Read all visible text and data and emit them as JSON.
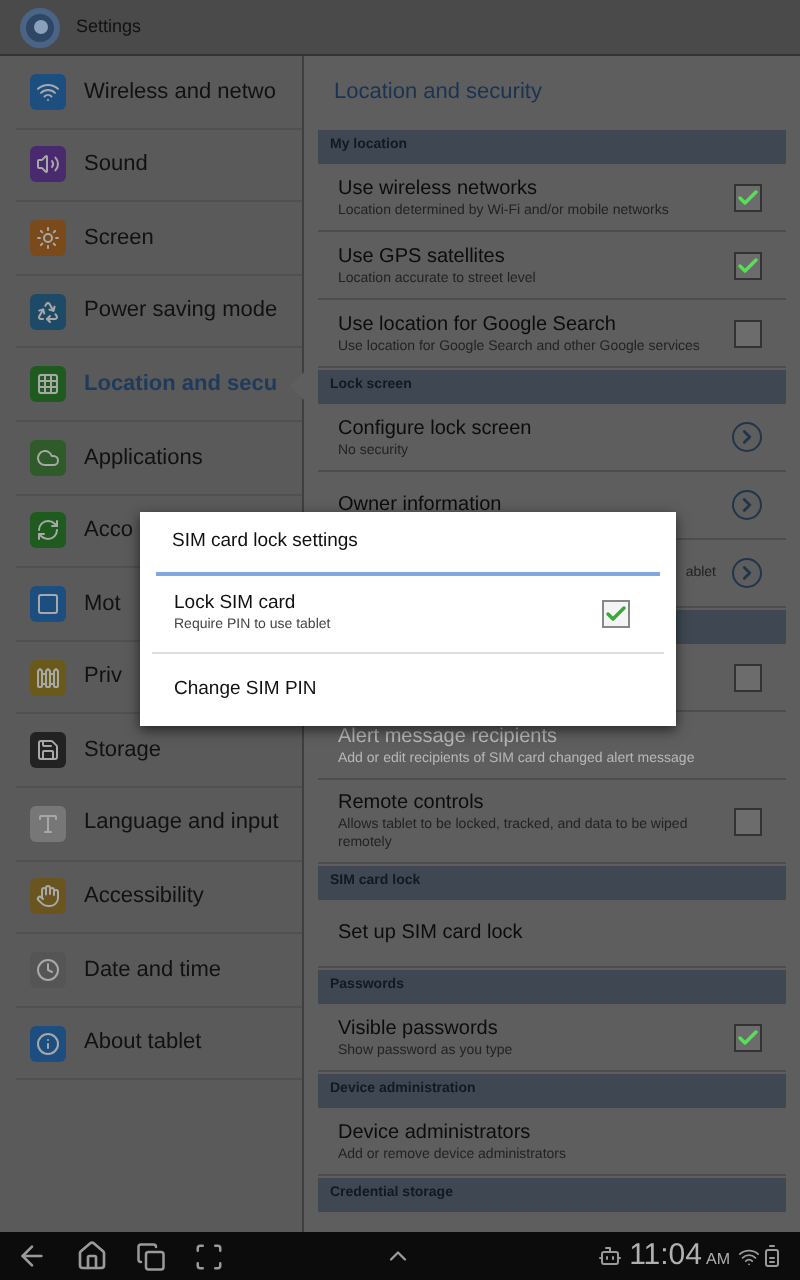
{
  "app_bar": {
    "title": "Settings"
  },
  "sidebar": {
    "items": [
      {
        "label": "Wireless and netwo",
        "selected": false
      },
      {
        "label": "Sound",
        "selected": false
      },
      {
        "label": "Screen",
        "selected": false
      },
      {
        "label": "Power saving mode",
        "selected": false
      },
      {
        "label": "Location and secu",
        "selected": true
      },
      {
        "label": "Applications",
        "selected": false
      },
      {
        "label": "Acco",
        "selected": false
      },
      {
        "label": "Mot",
        "selected": false
      },
      {
        "label": "Priv",
        "selected": false
      },
      {
        "label": "Storage",
        "selected": false
      },
      {
        "label": "Language and input",
        "selected": false
      },
      {
        "label": "Accessibility",
        "selected": false
      },
      {
        "label": "Date and time",
        "selected": false
      },
      {
        "label": "About tablet",
        "selected": false
      }
    ]
  },
  "panel": {
    "title": "Location and security",
    "rows": [
      {
        "kind": "header",
        "title": "My location"
      },
      {
        "kind": "check",
        "title": "Use wireless networks",
        "subtitle": "Location determined by Wi-Fi and/or mobile networks",
        "checked": true,
        "disabled": false
      },
      {
        "kind": "check",
        "title": "Use GPS satellites",
        "subtitle": "Location accurate to street level",
        "checked": true,
        "disabled": false
      },
      {
        "kind": "check",
        "title": "Use location for Google Search",
        "subtitle": "Use location for Google Search and other Google services",
        "checked": false,
        "disabled": false
      },
      {
        "kind": "header",
        "title": "Lock screen"
      },
      {
        "kind": "link",
        "title": "Configure lock screen",
        "subtitle": "No security",
        "disabled": false
      },
      {
        "kind": "link",
        "title": "Owner information",
        "disabled": false
      },
      {
        "kind": "link",
        "subtitle": "ablet",
        "disabled": false
      },
      {
        "kind": "header"
      },
      {
        "kind": "check",
        "checked": false
      },
      {
        "kind": "plain",
        "title": "Alert message recipients",
        "subtitle": "Add or edit recipients of SIM card changed alert message",
        "disabled": true
      },
      {
        "kind": "check",
        "title": "Remote controls",
        "subtitle": "Allows tablet to be locked, tracked, and data to be wiped remotely",
        "checked": false,
        "disabled": false
      },
      {
        "kind": "header",
        "title": "SIM card lock"
      },
      {
        "kind": "plain",
        "title": "Set up SIM card lock",
        "disabled": false
      },
      {
        "kind": "header",
        "title": "Passwords"
      },
      {
        "kind": "check",
        "title": "Visible passwords",
        "subtitle": "Show password as you type",
        "checked": true,
        "disabled": false
      },
      {
        "kind": "header",
        "title": "Device administration"
      },
      {
        "kind": "plain",
        "title": "Device administrators",
        "subtitle": "Add or remove device administrators",
        "disabled": false
      },
      {
        "kind": "header",
        "title": "Credential storage"
      }
    ]
  },
  "dialog": {
    "title": "SIM card lock settings",
    "items": [
      {
        "kind": "check",
        "title": "Lock SIM card",
        "subtitle": "Require PIN to use tablet",
        "checked": true
      },
      {
        "kind": "plain",
        "title": "Change SIM PIN"
      }
    ]
  },
  "nav_bar": {
    "time": "11:04",
    "ampm": "AM"
  }
}
